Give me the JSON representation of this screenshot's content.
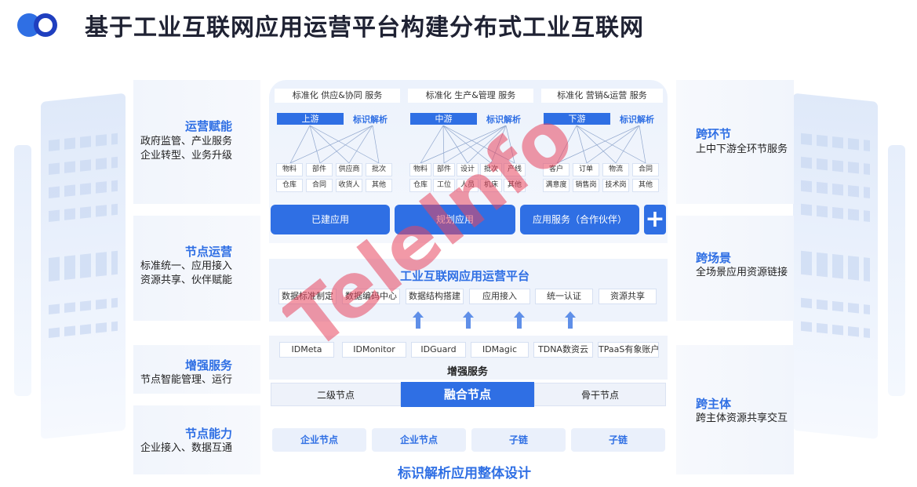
{
  "header": {
    "title": "基于工业互联网应用运营平台构建分布式工业互联网"
  },
  "left_panels": [
    {
      "title": "运营赋能",
      "lines": [
        "政府监管、产业服务",
        "企业转型、业务升级"
      ]
    },
    {
      "title": "节点运营",
      "lines": [
        "标准统一、应用接入",
        "资源共享、伙伴赋能"
      ]
    },
    {
      "title": "增强服务",
      "lines": [
        "节点智能管理、运行"
      ]
    },
    {
      "title": "节点能力",
      "lines": [
        "企业接入、数据互通"
      ]
    }
  ],
  "right_panels": [
    {
      "title": "跨环节",
      "lines": [
        "上中下游全环节服务"
      ]
    },
    {
      "title": "跨场景",
      "lines": [
        "全场景应用资源链接"
      ]
    },
    {
      "title": "跨主体",
      "lines": [
        "跨主体资源共享交互"
      ]
    }
  ],
  "categories": [
    {
      "label": "标准化 供应&协同 服务",
      "tag": "上游",
      "tag_text": "标识解析",
      "leaves": [
        [
          "物料",
          "部件",
          "供应商",
          "批次"
        ],
        [
          "仓库",
          "合同",
          "收货人",
          "其他"
        ]
      ]
    },
    {
      "label": "标准化 生产&管理 服务",
      "tag": "中游",
      "tag_text": "标识解析",
      "leaves": [
        [
          "物料",
          "部件",
          "设计",
          "批次",
          "产线"
        ],
        [
          "仓库",
          "工位",
          "人员",
          "机床",
          "其他"
        ]
      ]
    },
    {
      "label": "标准化 营销&运营 服务",
      "tag": "下游",
      "tag_text": "标识解析",
      "leaves": [
        [
          "客户",
          "订单",
          "物流",
          "合同"
        ],
        [
          "满意度",
          "销售岗",
          "技术岗",
          "其他"
        ]
      ]
    }
  ],
  "apps": {
    "built": "已建应用",
    "planned": "规划应用",
    "partner": "应用服务（合作伙伴）",
    "plus": "+"
  },
  "platform": {
    "title": "工业互联网应用运营平台",
    "functions": [
      "数据标准制定",
      "数据编码中心",
      "数据结构搭建",
      "应用接入",
      "统一认证",
      "资源共享"
    ]
  },
  "enhanced": {
    "items": [
      "IDMeta",
      "IDMonitor",
      "IDGuard",
      "IDMagic",
      "TDNA数资云",
      "TPaaS有象账户"
    ],
    "title": "增强服务"
  },
  "nodes": {
    "secondary": "二级节点",
    "fusion": "融合节点",
    "backbone": "骨干节点"
  },
  "capabilities": [
    "企业节点",
    "企业节点",
    "子链",
    "子链"
  ],
  "bottom_title": "标识解析应用整体设计",
  "watermark": "TeleInfo",
  "colors": {
    "accent": "#2f6fe4",
    "watermark": "#e8455f"
  }
}
